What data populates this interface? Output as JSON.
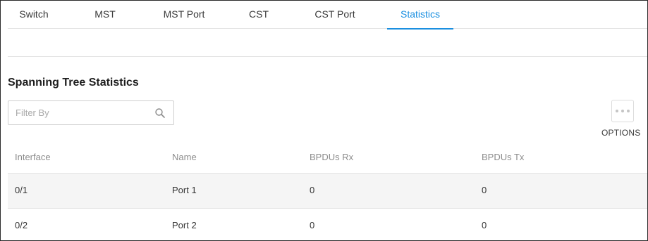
{
  "tabs": [
    {
      "label": "Switch",
      "active": false
    },
    {
      "label": "MST",
      "active": false
    },
    {
      "label": "MST Port",
      "active": false
    },
    {
      "label": "CST",
      "active": false
    },
    {
      "label": "CST Port",
      "active": false
    },
    {
      "label": "Statistics",
      "active": true
    }
  ],
  "section": {
    "title": "Spanning Tree Statistics"
  },
  "filter": {
    "placeholder": "Filter By",
    "value": "",
    "icon": "search-icon"
  },
  "options": {
    "label": "OPTIONS",
    "icon": "more-horizontal-icon"
  },
  "table": {
    "columns": [
      "Interface",
      "Name",
      "BPDUs Rx",
      "BPDUs Tx"
    ],
    "rows": [
      {
        "interface": "0/1",
        "name": "Port 1",
        "bpdus_rx": "0",
        "bpdus_tx": "0"
      },
      {
        "interface": "0/2",
        "name": "Port 2",
        "bpdus_rx": "0",
        "bpdus_tx": "0"
      }
    ]
  },
  "colors": {
    "accent": "#1a8fe0",
    "row_shade": "#f5f5f5",
    "border": "#e3e3e3"
  }
}
